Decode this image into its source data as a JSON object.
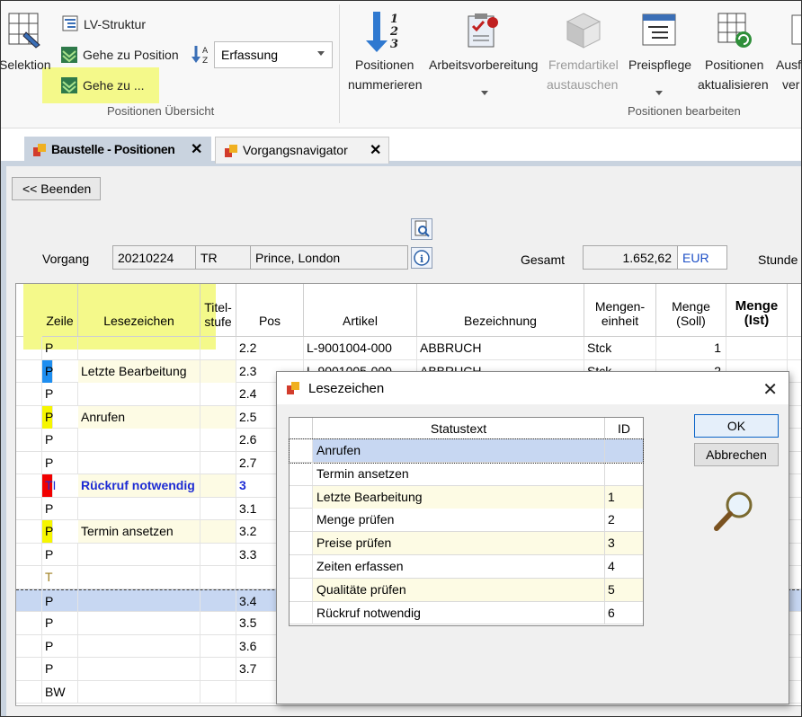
{
  "ribbon": {
    "selektion": "Selektion",
    "lv_struktur": "LV-Struktur",
    "gehe_zu_position": "Gehe zu Position",
    "gehe_zu": "Gehe zu ...",
    "erfassung": "Erfassung",
    "group1": "Positionen Übersicht",
    "pos_num_1": "Positionen",
    "pos_num_2": "nummerieren",
    "arbeit": "Arbeitsvorbereitung",
    "fremd_1": "Fremdartikel",
    "fremd_2": "austauschen",
    "preis": "Preispflege",
    "akt_1": "Positionen",
    "akt_2": "aktualisieren",
    "ausf_1": "Ausf",
    "ausf_2": "ver",
    "group2": "Positionen bearbeiten"
  },
  "tabs": [
    {
      "label": "Baustelle - Positionen"
    },
    {
      "label": "Vorgangsnavigator"
    }
  ],
  "toolbar": {
    "beenden": "<< Beenden"
  },
  "header": {
    "vorgang_label": "Vorgang",
    "vorgang": "20210224",
    "kuerzel": "TR",
    "kunde": "Prince, London",
    "gesamt_label": "Gesamt",
    "gesamt": "1.652,62",
    "waehrung": "EUR",
    "stunden_label": "Stunde"
  },
  "grid": {
    "columns": {
      "zeile": "Zeile",
      "lesezeichen": "Lesezeichen",
      "titel1": "Titel-",
      "titel2": "stufe",
      "pos": "Pos",
      "artikel": "Artikel",
      "bezeichnung": "Bezeichnung",
      "me1": "Mengen-",
      "me2": "einheit",
      "ms1": "Menge",
      "ms2": "(Soll)",
      "mi1": "Menge",
      "mi2": "(Ist)"
    },
    "rows": [
      {
        "zeile": "P",
        "lz": "",
        "pos": "2.2",
        "artikel": "L-9001004-000",
        "bez": "ABBRUCH",
        "einheit": "Stck",
        "menge": "1",
        "zcolor": "",
        "lcolor": ""
      },
      {
        "zeile": "P",
        "lz": "Letzte Bearbeitung",
        "pos": "2.3",
        "artikel": "L-9001005-000",
        "bez": "ABBRUCH",
        "einheit": "Stck",
        "menge": "2",
        "zcolor": "#1e8ef0",
        "lcolor": "#fdfbe4"
      },
      {
        "zeile": "P",
        "lz": "",
        "pos": "2.4",
        "artikel": "",
        "bez": "",
        "einheit": "",
        "menge": "",
        "zcolor": "",
        "lcolor": ""
      },
      {
        "zeile": "P",
        "lz": "Anrufen",
        "pos": "2.5",
        "artikel": "",
        "bez": "",
        "einheit": "",
        "menge": "",
        "zcolor": "#f6f600",
        "lcolor": "#fdfbe4"
      },
      {
        "zeile": "P",
        "lz": "",
        "pos": "2.6",
        "artikel": "",
        "bez": "",
        "einheit": "",
        "menge": "",
        "zcolor": "",
        "lcolor": ""
      },
      {
        "zeile": "P",
        "lz": "",
        "pos": "2.7",
        "artikel": "",
        "bez": "",
        "einheit": "",
        "menge": "",
        "zcolor": "",
        "lcolor": ""
      },
      {
        "zeile": "TI",
        "lz": "Rückruf notwendig",
        "pos": "3",
        "artikel": "",
        "bez": "",
        "einheit": "",
        "menge": "",
        "zcolor": "#f10000",
        "lcolor": "#fdfbe4",
        "bold": true
      },
      {
        "zeile": "P",
        "lz": "",
        "pos": "3.1",
        "artikel": "",
        "bez": "",
        "einheit": "",
        "menge": "",
        "zcolor": "",
        "lcolor": ""
      },
      {
        "zeile": "P",
        "lz": "Termin ansetzen",
        "pos": "3.2",
        "artikel": "",
        "bez": "",
        "einheit": "",
        "menge": "",
        "zcolor": "#f6f600",
        "lcolor": "#fdfbe4"
      },
      {
        "zeile": "P",
        "lz": "",
        "pos": "3.3",
        "artikel": "",
        "bez": "",
        "einheit": "",
        "menge": "",
        "zcolor": "",
        "lcolor": ""
      },
      {
        "zeile": "T",
        "lz": "",
        "pos": "",
        "artikel": "",
        "bez": "",
        "einheit": "",
        "menge": "",
        "zcolor": "",
        "lcolor": "",
        "tcolor": "#a08020"
      },
      {
        "zeile": "P",
        "lz": "",
        "pos": "3.4",
        "artikel": "",
        "bez": "",
        "einheit": "",
        "menge": "",
        "zcolor": "",
        "lcolor": "",
        "selected": true
      },
      {
        "zeile": "P",
        "lz": "",
        "pos": "3.5",
        "artikel": "",
        "bez": "",
        "einheit": "",
        "menge": "",
        "zcolor": "",
        "lcolor": ""
      },
      {
        "zeile": "P",
        "lz": "",
        "pos": "3.6",
        "artikel": "",
        "bez": "",
        "einheit": "",
        "menge": "",
        "zcolor": "",
        "lcolor": ""
      },
      {
        "zeile": "P",
        "lz": "",
        "pos": "3.7",
        "artikel": "",
        "bez": "",
        "einheit": "",
        "menge": "",
        "zcolor": "",
        "lcolor": ""
      },
      {
        "zeile": "BW",
        "lz": "",
        "pos": "",
        "artikel": "",
        "bez": "",
        "einheit": "",
        "menge": "",
        "zcolor": "",
        "lcolor": ""
      }
    ]
  },
  "dialog": {
    "title": "Lesezeichen",
    "col_status": "Statustext",
    "col_id": "ID",
    "rows": [
      {
        "text": "Anrufen",
        "id": ""
      },
      {
        "text": "Termin ansetzen",
        "id": ""
      },
      {
        "text": "Letzte Bearbeitung",
        "id": "1"
      },
      {
        "text": "Menge prüfen",
        "id": "2"
      },
      {
        "text": "Preise prüfen",
        "id": "3"
      },
      {
        "text": "Zeiten erfassen",
        "id": "4"
      },
      {
        "text": "Qualitäte prüfen",
        "id": "5"
      },
      {
        "text": "Rückruf notwendig",
        "id": "6"
      }
    ],
    "ok": "OK",
    "cancel": "Abbrechen"
  },
  "colors": {
    "highlight": "#f4f98a",
    "accent": "#c9d3df",
    "selected_row": "#c7d7f2"
  }
}
